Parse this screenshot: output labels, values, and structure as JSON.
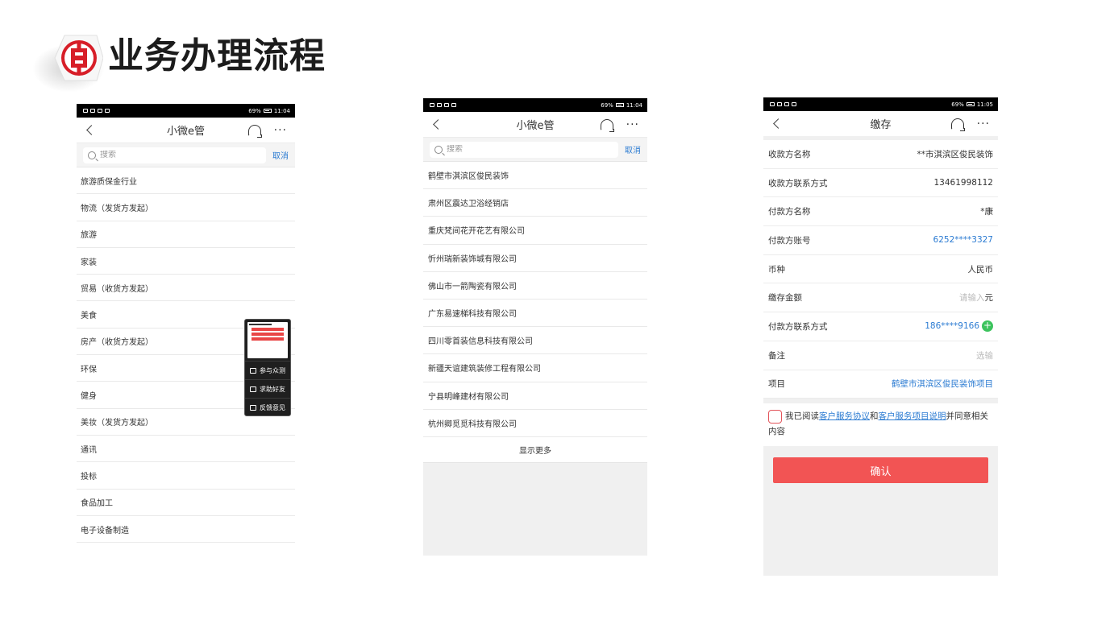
{
  "slide": {
    "title": "业务办理流程",
    "logo_color": "#d71e28"
  },
  "status_bar": {
    "time_1": "11:04",
    "time_2": "11:04",
    "time_3": "11:05",
    "battery": "69%"
  },
  "phone1": {
    "nav_title": "小微e管",
    "search_placeholder": "搜索",
    "cancel_label": "取消",
    "items": [
      "旅游质保金行业",
      "物流（发货方发起）",
      "旅游",
      "家装",
      "贸易（收货方发起）",
      "美食",
      "房产（收货方发起）",
      "环保",
      "健身",
      "美妆（发货方发起）",
      "通讯",
      "投标",
      "食品加工",
      "电子设备制造"
    ],
    "popup": {
      "items": [
        "参与众测",
        "求助好友",
        "反馈意见"
      ]
    }
  },
  "phone2": {
    "nav_title": "小微e管",
    "search_placeholder": "搜索",
    "cancel_label": "取消",
    "items": [
      "鹤壁市淇滨区俊民装饰",
      "肃州区震达卫浴经销店",
      "重庆梵间花开花艺有限公司",
      "忻州瑞新装饰城有限公司",
      "佛山市一箭陶瓷有限公司",
      "广东易速梯科技有限公司",
      "四川零首装信息科技有限公司",
      "新疆天谊建筑装修工程有限公司",
      "宁县明峰建材有限公司",
      "杭州卿觅觅科技有限公司"
    ],
    "show_more": "显示更多"
  },
  "phone3": {
    "nav_title": "缴存",
    "rows": [
      {
        "label": "收款方名称",
        "value": "**市淇滨区俊民装饰"
      },
      {
        "label": "收款方联系方式",
        "value": "13461998112"
      },
      {
        "label": "付款方名称",
        "value": "*康"
      },
      {
        "label": "付款方账号",
        "value": "6252****3327"
      },
      {
        "label": "币种",
        "value": "人民币"
      },
      {
        "label": "缴存金额",
        "placeholder": "请输入",
        "unit": "元"
      },
      {
        "label": "付款方联系方式",
        "value": "186****9166"
      },
      {
        "label": "备注",
        "placeholder": "选输"
      },
      {
        "label": "项目",
        "value": "鹤壁市淇滨区俊民装饰项目"
      }
    ],
    "agree": {
      "prefix": "我已阅读",
      "link1": "客户服务协议",
      "mid": "和",
      "link2": "客户服务项目说明",
      "suffix": "并同意相关内容"
    },
    "confirm_label": "确认"
  },
  "colors": {
    "link": "#2b7bd2",
    "confirm": "#f25454",
    "add": "#3cc35d"
  }
}
